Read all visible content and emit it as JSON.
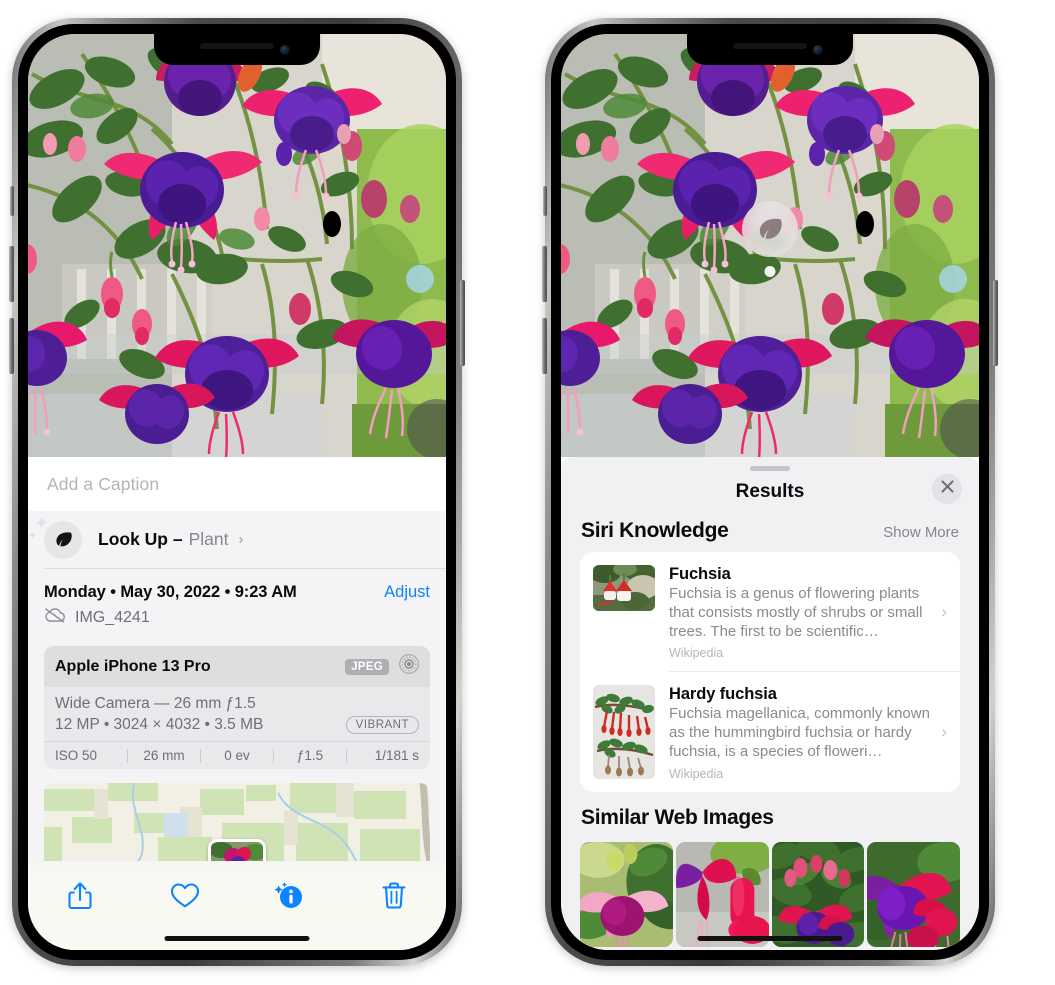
{
  "left_phone": {
    "caption": {
      "placeholder": "Add a Caption"
    },
    "lookup": {
      "label": "Look Up –",
      "subject": "Plant",
      "chevron": "›",
      "icon": "leaf-icon"
    },
    "meta": {
      "date": "Monday • May 30, 2022 • 9:23 AM",
      "adjust_label": "Adjust",
      "filename": "IMG_4241",
      "cloud_icon": "cloud-slash-icon"
    },
    "camera": {
      "model": "Apple iPhone 13 Pro",
      "format_badge": "JPEG",
      "raw_icon": "aperture-icon",
      "lens_line": "Wide Camera — 26 mm ƒ1.5",
      "spec_line": "12 MP • 3024 × 4032 • 3.5 MB",
      "style_badge": "VIBRANT",
      "exif": [
        "ISO 50",
        "26 mm",
        "0 ev",
        "ƒ1.5",
        "1/181 s"
      ]
    },
    "toolbar": [
      {
        "name": "share-icon",
        "label": "Share"
      },
      {
        "name": "heart-icon",
        "label": "Favorite"
      },
      {
        "name": "info-icon",
        "label": "Info"
      },
      {
        "name": "trash-icon",
        "label": "Delete"
      }
    ]
  },
  "right_phone": {
    "visual_lookup_badge": {
      "icon": "leaf-icon"
    },
    "sheet": {
      "title": "Results",
      "close_icon": "close-icon"
    },
    "siri_knowledge": {
      "title": "Siri Knowledge",
      "action": "Show More",
      "items": [
        {
          "title": "Fuchsia",
          "description": "Fuchsia is a genus of flowering plants that consists mostly of shrubs or small trees. The first to be scientific…",
          "source": "Wikipedia",
          "chevron": "›"
        },
        {
          "title": "Hardy fuchsia",
          "description": "Fuchsia magellanica, commonly known as the hummingbird fuchsia or hardy fuchsia, is a species of floweri…",
          "source": "Wikipedia",
          "chevron": "›"
        }
      ]
    },
    "similar_web_images": {
      "title": "Similar Web Images",
      "count": 4
    }
  },
  "colors": {
    "accent_blue": "#0b84ff",
    "sheet_bg": "#f1f1f4",
    "card_bg": "#ffffff",
    "secondary_text": "#8a8a8f"
  }
}
